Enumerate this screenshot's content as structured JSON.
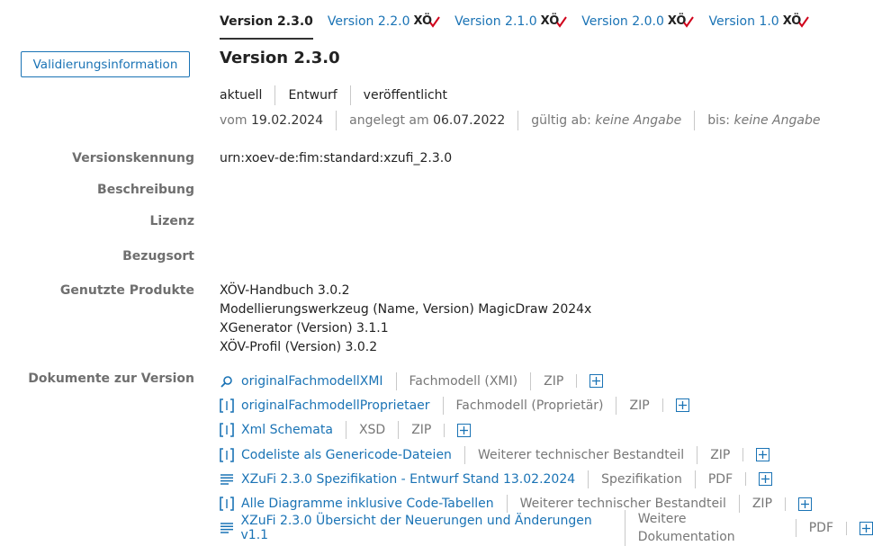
{
  "tabs": [
    {
      "label": "Version 2.3.0",
      "active": true,
      "xoev": false
    },
    {
      "label": "Version 2.2.0",
      "active": false,
      "xoev": true
    },
    {
      "label": "Version 2.1.0",
      "active": false,
      "xoev": true
    },
    {
      "label": "Version 2.0.0",
      "active": false,
      "xoev": true
    },
    {
      "label": "Version 1.0",
      "active": false,
      "xoev": true
    }
  ],
  "xoev_mark": "XÖ",
  "validation_button": "Validierungsinformation",
  "title": "Version 2.3.0",
  "status": [
    "aktuell",
    "Entwurf",
    "veröffentlicht"
  ],
  "dates": {
    "vom_label": "vom",
    "vom_value": "19.02.2024",
    "angelegt_label": "angelegt am",
    "angelegt_value": "06.07.2022",
    "gueltig_label": "gültig ab:",
    "gueltig_value": "keine Angabe",
    "bis_label": "bis:",
    "bis_value": "keine Angabe"
  },
  "fields": {
    "versionskennung_label": "Versionskennung",
    "versionskennung_value": "urn:xoev-de:fim:standard:xzufi_2.3.0",
    "beschreibung_label": "Beschreibung",
    "lizenz_label": "Lizenz",
    "bezugsort_label": "Bezugsort",
    "produkte_label": "Genutzte Produkte",
    "produkte": [
      "XÖV-Handbuch 3.0.2",
      "Modellierungswerkzeug (Name, Version) MagicDraw 2024x",
      "XGenerator (Version) 3.1.1",
      "XÖV-Profil (Version) 3.0.2"
    ],
    "dokumente_label": "Dokumente zur Version"
  },
  "documents": [
    {
      "icon": "search-zoom-icon",
      "name": "originalFachmodellXMI",
      "type": "Fachmodell (XMI)",
      "format": "ZIP"
    },
    {
      "icon": "code-bracket-icon",
      "name": "originalFachmodellProprietaer",
      "type": "Fachmodell (Proprietär)",
      "format": "ZIP"
    },
    {
      "icon": "code-bracket-icon",
      "name": "Xml Schemata",
      "type": "XSD",
      "format": "ZIP"
    },
    {
      "icon": "code-bracket-icon",
      "name": "Codeliste als Genericode-Dateien",
      "type": "Weiterer technischer Bestandteil",
      "format": "ZIP"
    },
    {
      "icon": "document-lines-icon",
      "name": "XZuFi 2.3.0 Spezifikation - Entwurf Stand 13.02.2024",
      "type": "Spezifikation",
      "format": "PDF"
    },
    {
      "icon": "code-bracket-icon",
      "name": "Alle Diagramme inklusive Code-Tabellen",
      "type": "Weiterer technischer Bestandteil",
      "format": "ZIP"
    },
    {
      "icon": "document-lines-icon",
      "name": "XZuFi 2.3.0 Übersicht der Neuerungen und Änderungen v1.1",
      "type": "Weitere Dokumentation",
      "format": "PDF"
    }
  ],
  "colors": {
    "link": "#1a73b5",
    "check": "#d0021b",
    "label": "#6f6f6f"
  }
}
